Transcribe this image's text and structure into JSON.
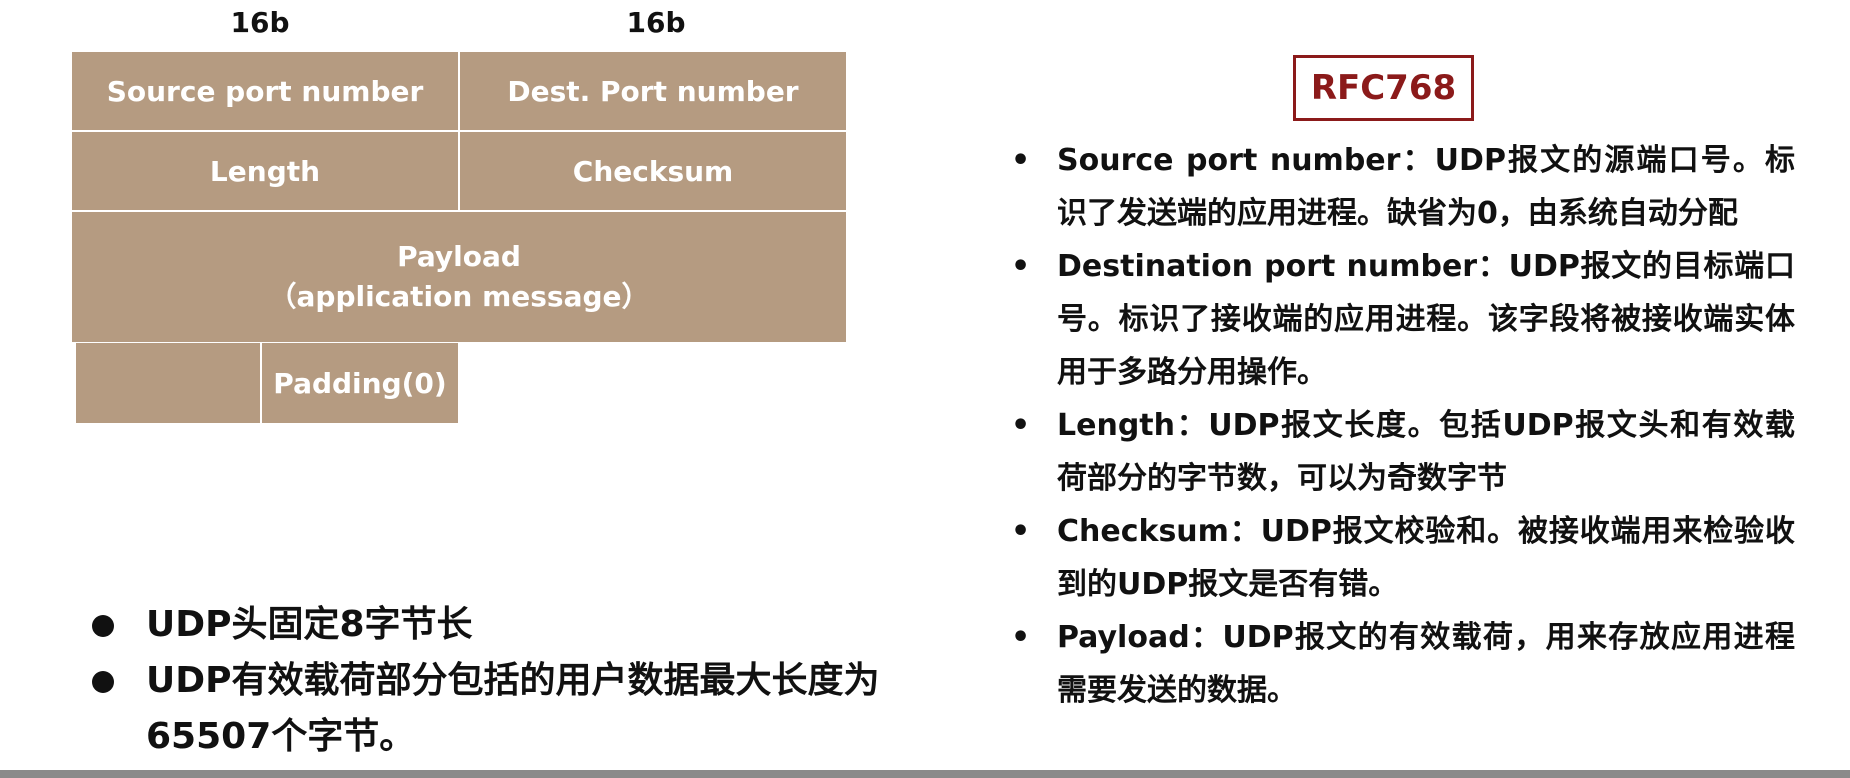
{
  "diagram": {
    "bit_labels": [
      "16b",
      "16b"
    ],
    "fields": {
      "source_port": "Source port number",
      "dest_port": "Dest. Port number",
      "length": "Length",
      "checksum": "Checksum",
      "payload_line1": "Payload",
      "payload_line2": "（application message）",
      "padding": "Padding(0)"
    }
  },
  "rfc_label": "RFC768",
  "descriptions": [
    "Source port number：UDP报文的源端口号。标识了发送端的应用进程。缺省为0，由系统自动分配",
    "Destination port number：UDP报文的目标端口号。标识了接收端的应用进程。该字段将被接收端实体用于多路分用操作。",
    "Length：UDP报文长度。包括UDP报文头和有效载荷部分的字节数，可以为奇数字节",
    "Checksum：UDP报文校验和。被接收端用来检验收到的UDP报文是否有错。",
    "Payload：UDP报文的有效载荷，用来存放应用进程需要发送的数据。"
  ],
  "summary": [
    "UDP头固定8字节长",
    "UDP有效载荷部分包括的用户数据最大长度为65507个字节。"
  ],
  "colors": {
    "cell_fill": "#b59b81",
    "rfc_accent": "#8b1a1a"
  }
}
